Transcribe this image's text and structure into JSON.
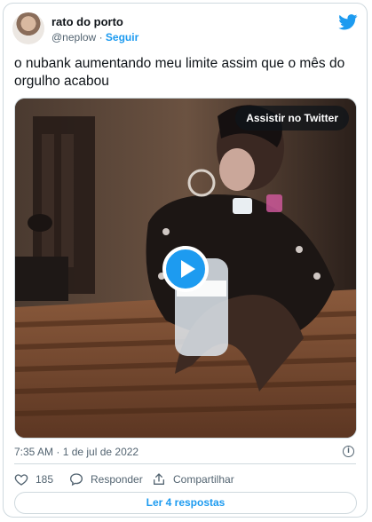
{
  "author": {
    "name": "rato do porto",
    "handle": "@neplow",
    "separator": "·",
    "follow_label": "Seguir"
  },
  "tweet": {
    "text": "o nubank aumentando meu limite assim que o mês do orgulho acabou",
    "timestamp": "7:35 AM · 1 de jul de 2022"
  },
  "media": {
    "watch_label": "Assistir no Twitter"
  },
  "actions": {
    "likes": "185",
    "reply_label": "Responder",
    "share_label": "Compartilhar"
  },
  "replies_button": "Ler 4 respostas",
  "colors": {
    "accent": "#1d9bf0",
    "text": "#0f1419",
    "secondary": "#536471",
    "border": "#cfd9de"
  }
}
